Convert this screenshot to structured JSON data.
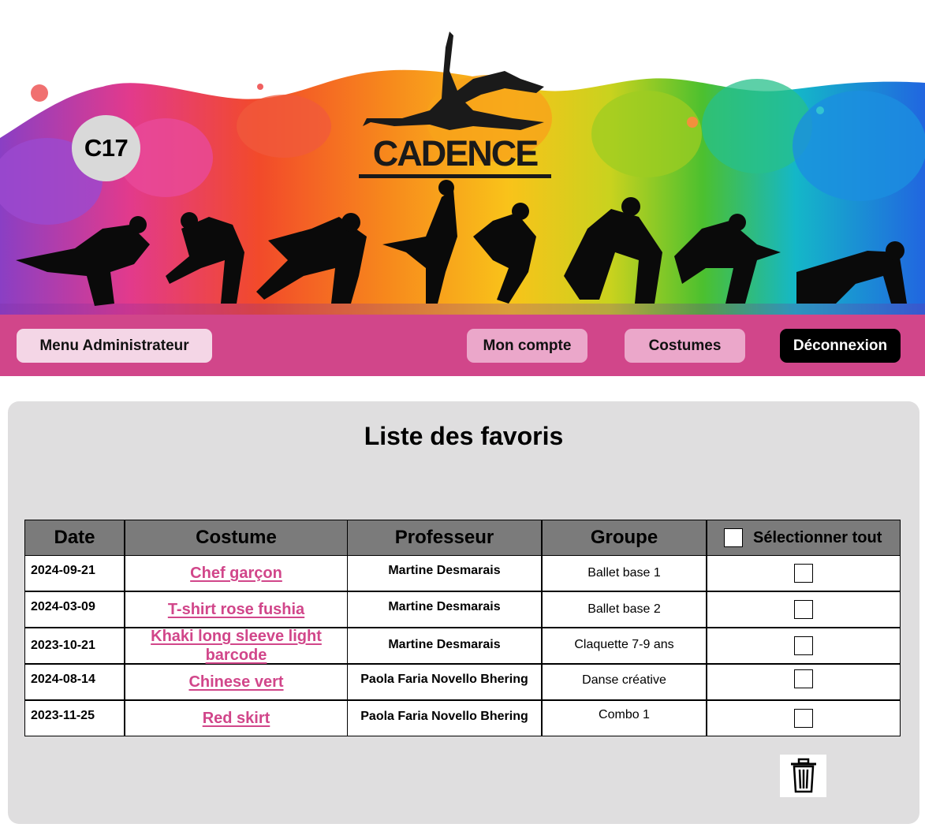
{
  "header": {
    "page_code": "C17",
    "brand_name": "CADENCE"
  },
  "nav": {
    "admin_menu": "Menu Administrateur",
    "my_account": "Mon compte",
    "costumes": "Costumes",
    "logout": "Déconnexion"
  },
  "favorites": {
    "title": "Liste des favoris",
    "columns": {
      "date": "Date",
      "costume": "Costume",
      "teacher": "Professeur",
      "group": "Groupe",
      "select_all": "Sélectionner tout"
    },
    "rows": [
      {
        "date": "2024-09-21",
        "costume": "Chef garçon",
        "teacher": "Martine Desmarais",
        "group": "Ballet base 1",
        "checked": false
      },
      {
        "date": "2024-03-09",
        "costume": "T-shirt rose fushia",
        "teacher": "Martine Desmarais",
        "group": "Ballet base 2",
        "checked": false
      },
      {
        "date": "2023-10-21",
        "costume": "Khaki long sleeve light barcode",
        "teacher": "Martine Desmarais",
        "group": "Claquette 7-9 ans",
        "checked": false
      },
      {
        "date": "2024-08-14",
        "costume": "Chinese vert",
        "teacher": "Paola Faria Novello Bhering",
        "group": "Danse créative",
        "checked": false
      },
      {
        "date": "2023-11-25",
        "costume": "Red skirt",
        "teacher": "Paola Faria Novello Bhering",
        "group": "Combo 1",
        "checked": false
      }
    ],
    "delete_icon": "trash-icon"
  },
  "colors": {
    "nav_background": "#d1468a",
    "link_color": "#d1468a",
    "panel_background": "#dfdedf",
    "header_cell_background": "#7b7b7b",
    "logout_background": "#000000"
  }
}
